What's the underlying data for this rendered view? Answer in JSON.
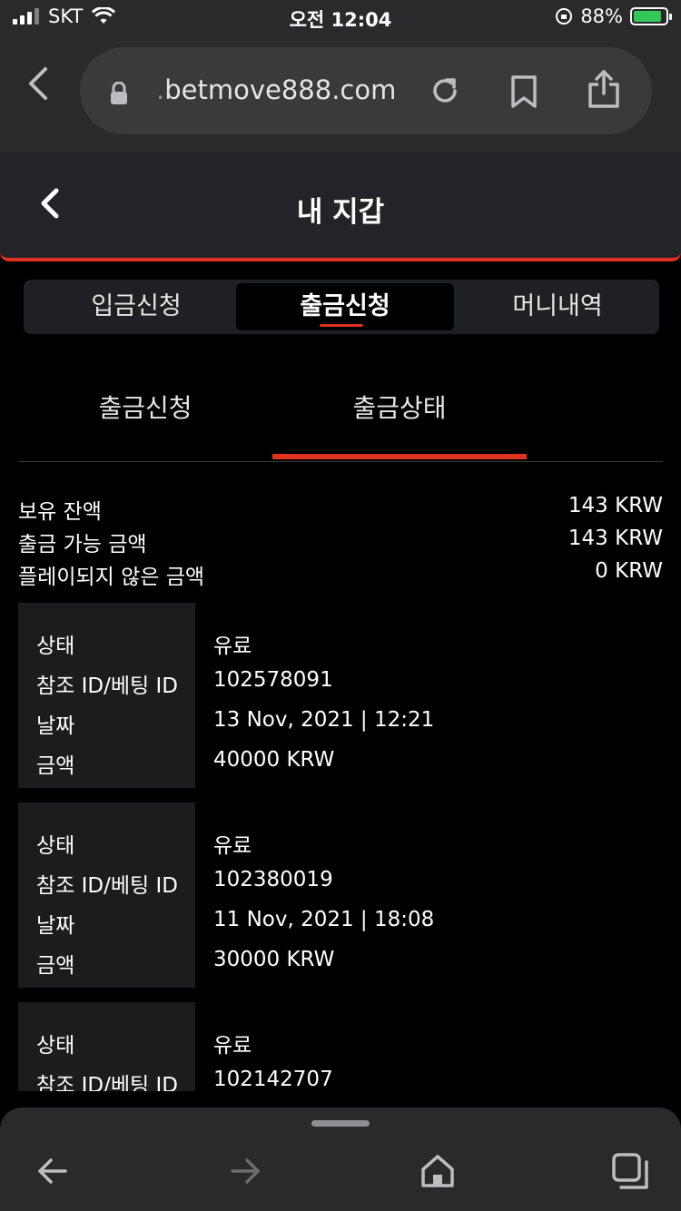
{
  "status_bar": {
    "carrier": "SKT",
    "time": "오전 12:04",
    "battery": "88%",
    "battery_level": 0.88
  },
  "browser": {
    "url_prefix": ".",
    "url_domain": "betmove888.com",
    "icons": [
      "back-chevron-icon",
      "lock-icon",
      "reload-icon",
      "bookmark-icon",
      "share-icon"
    ]
  },
  "header": {
    "title": "내 지갑"
  },
  "segment_tabs": [
    {
      "label": "입금신청"
    },
    {
      "label": "출금신청"
    },
    {
      "label": "머니내역"
    }
  ],
  "sub_tabs": [
    {
      "label": "출금신청"
    },
    {
      "label": "출금상태"
    }
  ],
  "balances": [
    {
      "label": "보유 잔액",
      "value": "143 KRW"
    },
    {
      "label": "출금 가능 금액",
      "value": "143 KRW"
    },
    {
      "label": "플레이되지 않은 금액",
      "value": "0 KRW"
    }
  ],
  "record_labels": {
    "status": "상태",
    "ref": "참조 ID/베팅 ID",
    "date": "날짜",
    "amount": "금액"
  },
  "records": [
    {
      "status": "유료",
      "ref": "102578091",
      "date": "13 Nov, 2021 | 12:21",
      "amount": "40000 KRW"
    },
    {
      "status": "유료",
      "ref": "102380019",
      "date": "11 Nov, 2021 | 18:08",
      "amount": "30000 KRW"
    },
    {
      "status": "유료",
      "ref": "102142707"
    }
  ],
  "colors": {
    "accent": "#e0301e",
    "battery_green": "#34c759"
  }
}
